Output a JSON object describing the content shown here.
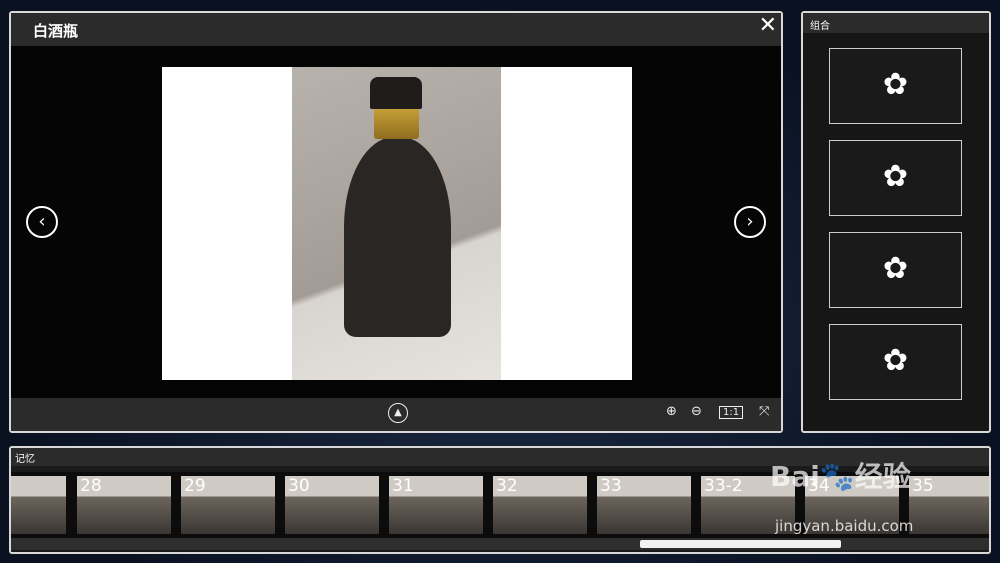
{
  "viewer": {
    "title": "白酒瓶",
    "prev_icon": "chevron-left-icon",
    "next_icon": "chevron-right-icon",
    "ratio_label": "1:1"
  },
  "combo": {
    "title": "组合",
    "slot_icon": "brain-icon",
    "slot_glyph": "✿"
  },
  "memory": {
    "title": "记忆",
    "thumbs": [
      "",
      "28",
      "29",
      "30",
      "31",
      "32",
      "33",
      "33-2",
      "34",
      "35"
    ],
    "scroll_position_percent": 64
  },
  "watermark": {
    "logo": "Bai经验",
    "url": "jingyan.baidu.com"
  }
}
